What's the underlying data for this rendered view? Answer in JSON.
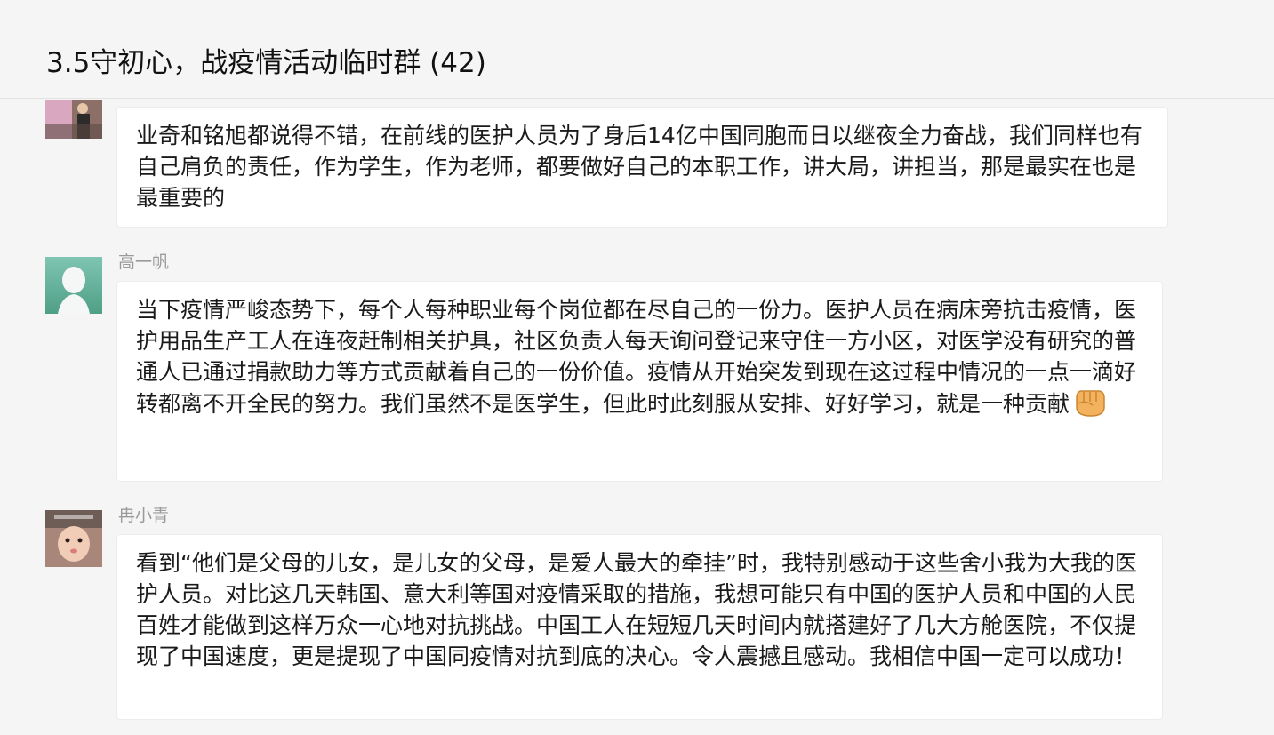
{
  "chat": {
    "title": "3.5守初心，战疫情活动临时群 (42)"
  },
  "messages": [
    {
      "sender": "",
      "text": "业奇和铭旭都说得不错，在前线的医护人员为了身后14亿中国同胞而日以继夜全力奋战，我们同样也有自己肩负的责任，作为学生，作为老师，都要做好自己的本职工作，讲大局，讲担当，那是最实在也是最重要的"
    },
    {
      "sender": "高一帆",
      "text": "当下疫情严峻态势下，每个人每种职业每个岗位都在尽自己的一份力。医护人员在病床旁抗击疫情，医护用品生产工人在连夜赶制相关护具，社区负责人每天询问登记来守住一方小区，对医学没有研究的普通人已通过捐款助力等方式贡献着自己的一份价值。疫情从开始突发到现在这过程中情况的一点一滴好转都离不开全民的努力。我们虽然不是医学生，但此时此刻服从安排、好好学习，就是一种贡献",
      "emoji": "fist-emoji-icon"
    },
    {
      "sender": "冉小青",
      "text": "看到“他们是父母的儿女，是儿女的父母，是爱人最大的牵挂”时，我特别感动于这些舍小我为大我的医护人员。对比这几天韩国、意大利等国对疫情采取的措施，我想可能只有中国的医护人员和中国的人民百姓才能做到这样万众一心地对抗挑战。中国工人在短短几天时间内就搭建好了几大方舱医院，不仅提现了中国速度，更是提现了中国同疫情对抗到底的决心。令人震撼且感动。我相信中国一定可以成功！"
    }
  ]
}
